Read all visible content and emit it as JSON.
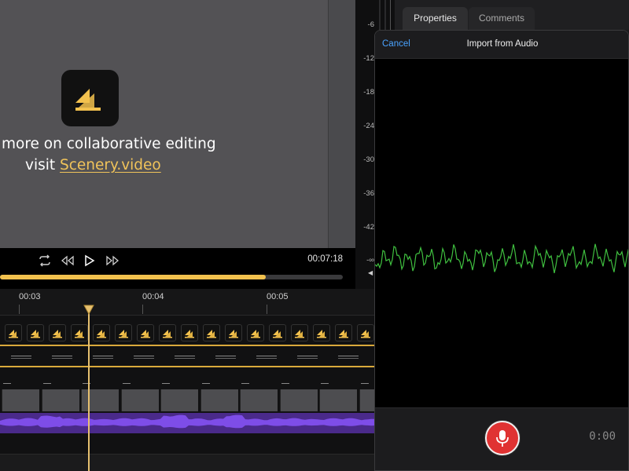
{
  "preview": {
    "line1": "more on collaborative editing",
    "line2_prefix": "visit ",
    "link": "Scenery.video"
  },
  "transport": {
    "time": "00:07:18",
    "progress": 0.775
  },
  "meter": {
    "labels": [
      "-6",
      "-12",
      "-18",
      "-24",
      "-30",
      "-36",
      "-42",
      "-∞"
    ]
  },
  "tabs": [
    {
      "label": "Properties",
      "active": true
    },
    {
      "label": "Comments",
      "active": false
    }
  ],
  "timeline": {
    "ticks": [
      "00:03",
      "00:04",
      "00:05"
    ]
  },
  "modal": {
    "cancel_label": "Cancel",
    "title": "Import from Audio",
    "rec_time": "0:00"
  },
  "colors": {
    "accent": "#f2c14e",
    "waveform": "#3fbf3f",
    "record": "#e03232",
    "link": "#4aa3ff",
    "audio_track": "#6a3ad1"
  }
}
